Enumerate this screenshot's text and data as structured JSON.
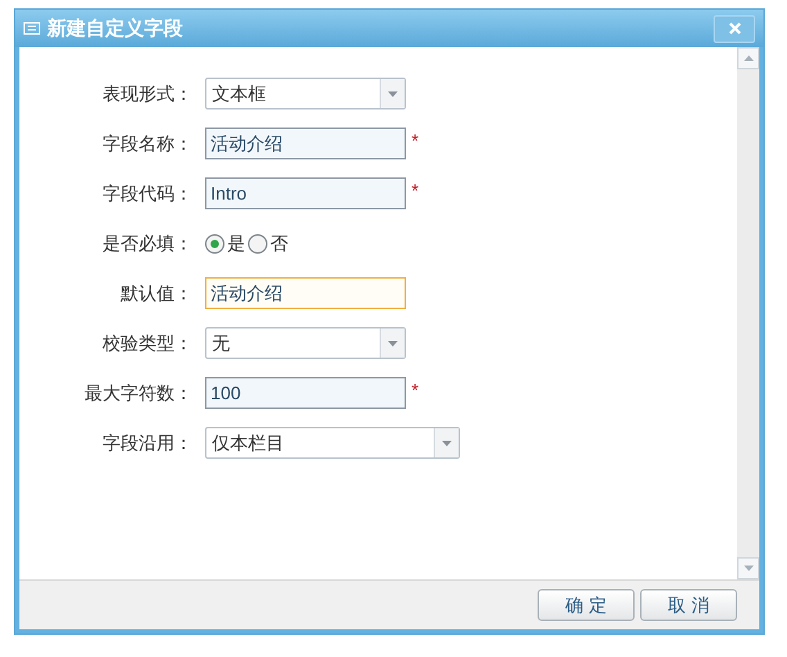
{
  "window": {
    "title": "新建自定义字段"
  },
  "fields": [
    {
      "kind": "select",
      "label": "表现形式：",
      "value": "文本框",
      "wide": false
    },
    {
      "kind": "text",
      "label": "字段名称：",
      "value": "活动介绍",
      "required": true,
      "focused": false
    },
    {
      "kind": "text",
      "label": "字段代码：",
      "value": "Intro",
      "required": true,
      "focused": false
    },
    {
      "kind": "radio",
      "label": "是否必填：",
      "options": [
        {
          "label": "是",
          "selected": true
        },
        {
          "label": "否",
          "selected": false
        }
      ]
    },
    {
      "kind": "text",
      "label": "默认值：",
      "value": "活动介绍",
      "required": false,
      "focused": true
    },
    {
      "kind": "select",
      "label": "校验类型：",
      "value": "无",
      "wide": false
    },
    {
      "kind": "text",
      "label": "最大字符数：",
      "value": "100",
      "required": true,
      "focused": false
    },
    {
      "kind": "select",
      "label": "字段沿用：",
      "value": "仅本栏目",
      "wide": true
    }
  ],
  "required_mark": "*",
  "buttons": [
    "确 定",
    "取 消"
  ]
}
